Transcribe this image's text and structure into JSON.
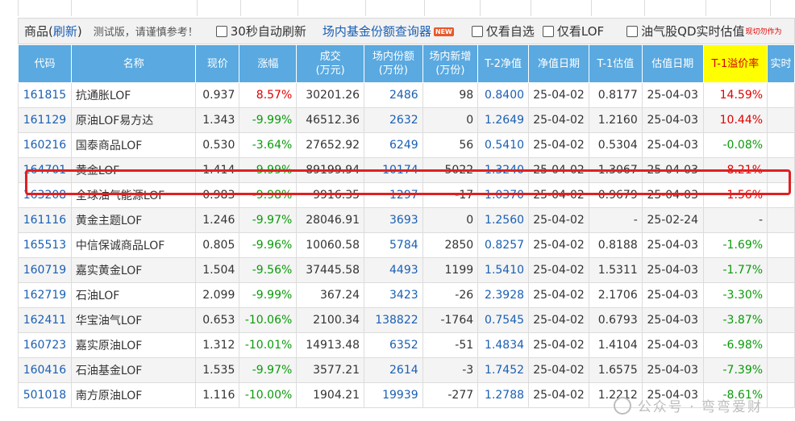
{
  "toolbar": {
    "title": "商品",
    "refresh_label": "刷新",
    "note": "测试版，请谨慎参考！",
    "auto_refresh_label": "30秒自动刷新",
    "query_link": "场内基金份额查询器",
    "new_badge": "NEW",
    "watchlist_label": "仅看自选",
    "lof_only_label": "仅看LOF",
    "qd_label": "油气股QD实时估值",
    "qd_note": "现切勿作为"
  },
  "table": {
    "headers": [
      {
        "label": "代码"
      },
      {
        "label": "名称"
      },
      {
        "label": "现价"
      },
      {
        "label": "涨幅"
      },
      {
        "label": "成交",
        "sub": "(万元)"
      },
      {
        "label": "场内份额",
        "sub": "(万份)"
      },
      {
        "label": "场内新增",
        "sub": "(万份)"
      },
      {
        "label": "T-2净值"
      },
      {
        "label": "净值日期"
      },
      {
        "label": "T-1估值"
      },
      {
        "label": "估值日期"
      },
      {
        "label": "T-1溢价率"
      },
      {
        "label": "实时"
      }
    ],
    "rows": [
      {
        "code": "161815",
        "name": "抗通胀LOF",
        "price": "0.937",
        "change": "8.57%",
        "volume": "30201.26",
        "shares": "2486",
        "new_shares": "98",
        "nav_t2": "0.8400",
        "nav_date": "25-04-02",
        "est_t1": "0.8177",
        "est_date": "25-04-03",
        "premium": "14.59%"
      },
      {
        "code": "161129",
        "name": "原油LOF易方达",
        "price": "1.343",
        "change": "-9.99%",
        "volume": "46512.36",
        "shares": "2632",
        "new_shares": "0",
        "nav_t2": "1.2649",
        "nav_date": "25-04-02",
        "est_t1": "1.2160",
        "est_date": "25-04-03",
        "premium": "10.44%"
      },
      {
        "code": "160216",
        "name": "国泰商品LOF",
        "price": "0.530",
        "change": "-3.64%",
        "volume": "27652.92",
        "shares": "6249",
        "new_shares": "56",
        "nav_t2": "0.5410",
        "nav_date": "25-04-02",
        "est_t1": "0.5304",
        "est_date": "25-04-03",
        "premium": "-0.08%"
      },
      {
        "code": "164701",
        "name": "黄金LOF",
        "price": "1.414",
        "change": "-9.99%",
        "volume": "89199.94",
        "shares": "10174",
        "new_shares": "5022",
        "nav_t2": "1.3240",
        "nav_date": "25-04-02",
        "est_t1": "1.3067",
        "est_date": "25-04-03",
        "premium": "8.21%"
      },
      {
        "code": "163208",
        "name": "全球油气能源LOF",
        "price": "0.983",
        "change": "-9.98%",
        "volume": "9916.35",
        "shares": "1297",
        "new_shares": "-17",
        "nav_t2": "1.0370",
        "nav_date": "25-04-02",
        "est_t1": "0.9679",
        "est_date": "25-04-03",
        "premium": "1.56%"
      },
      {
        "code": "161116",
        "name": "黄金主题LOF",
        "price": "1.246",
        "change": "-9.97%",
        "volume": "28046.91",
        "shares": "3693",
        "new_shares": "0",
        "nav_t2": "1.2560",
        "nav_date": "25-04-02",
        "est_t1": "-",
        "est_date": "25-02-24",
        "premium": "-"
      },
      {
        "code": "165513",
        "name": "中信保诚商品LOF",
        "price": "0.805",
        "change": "-9.96%",
        "volume": "10060.58",
        "shares": "5784",
        "new_shares": "2850",
        "nav_t2": "0.8257",
        "nav_date": "25-04-02",
        "est_t1": "0.8188",
        "est_date": "25-04-03",
        "premium": "-1.69%"
      },
      {
        "code": "160719",
        "name": "嘉实黄金LOF",
        "price": "1.504",
        "change": "-9.56%",
        "volume": "37445.58",
        "shares": "4493",
        "new_shares": "1199",
        "nav_t2": "1.5410",
        "nav_date": "25-04-02",
        "est_t1": "1.5311",
        "est_date": "25-04-03",
        "premium": "-1.77%"
      },
      {
        "code": "162719",
        "name": "石油LOF",
        "price": "2.099",
        "change": "-9.99%",
        "volume": "367.24",
        "shares": "3423",
        "new_shares": "-26",
        "nav_t2": "2.3928",
        "nav_date": "25-04-02",
        "est_t1": "2.1706",
        "est_date": "25-04-03",
        "premium": "-3.30%"
      },
      {
        "code": "162411",
        "name": "华宝油气LOF",
        "price": "0.653",
        "change": "-10.06%",
        "volume": "2100.34",
        "shares": "138822",
        "new_shares": "-1764",
        "nav_t2": "0.7545",
        "nav_date": "25-04-02",
        "est_t1": "0.6793",
        "est_date": "25-04-03",
        "premium": "-3.87%"
      },
      {
        "code": "160723",
        "name": "嘉实原油LOF",
        "price": "1.312",
        "change": "-10.01%",
        "volume": "14913.48",
        "shares": "6352",
        "new_shares": "-51",
        "nav_t2": "1.4834",
        "nav_date": "25-04-02",
        "est_t1": "1.4104",
        "est_date": "25-04-03",
        "premium": "-6.98%"
      },
      {
        "code": "160416",
        "name": "石油基金LOF",
        "price": "1.535",
        "change": "-9.97%",
        "volume": "3577.21",
        "shares": "2614",
        "new_shares": "-3",
        "nav_t2": "1.7452",
        "nav_date": "25-04-02",
        "est_t1": "1.6575",
        "est_date": "25-04-03",
        "premium": "-7.39%"
      },
      {
        "code": "501018",
        "name": "南方原油LOF",
        "price": "1.116",
        "change": "-10.00%",
        "volume": "1904.21",
        "shares": "19939",
        "new_shares": "-277",
        "nav_t2": "1.2788",
        "nav_date": "25-04-02",
        "est_t1": "1.2212",
        "est_date": "25-04-03",
        "premium": "-8.61%"
      }
    ]
  },
  "watermark": {
    "text": "公众号 · 弯弯爱财"
  },
  "colors": {
    "header_bg": "#5aa9e0",
    "highlight_header": "#ffff00",
    "up": "#e00000",
    "down": "#0a9a0a",
    "link": "#1a5fb4",
    "highlight_border": "#e02020"
  }
}
